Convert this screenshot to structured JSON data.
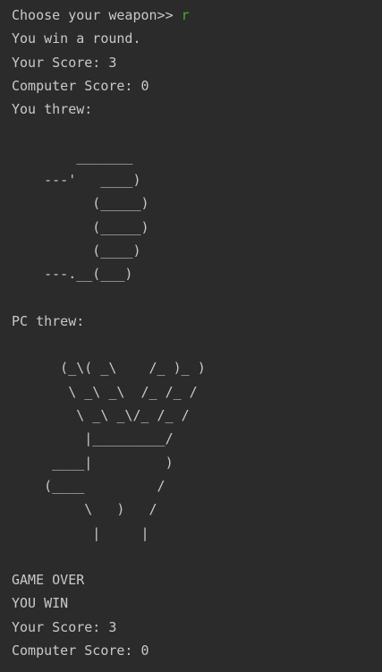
{
  "console": {
    "prompt": "Choose your weapon>> ",
    "user_input": "r",
    "round_result": "You win a round.",
    "score_line_1": "Your Score: 3",
    "computer_score_line_1": "Computer Score: 0",
    "you_threw_label": "You threw:",
    "rock_art": "        _______\n    ---'   ____)\n          (_____)\n          (_____)\n          (____)\n    ---.__(___)",
    "pc_threw_label": "PC threw:",
    "scissors_art": "      (_\\( _\\    /_ )_ )\n       \\ _\\ _\\  /_ /_ /\n        \\ _\\ _\\/_ /_ /\n         |_________/\n     ____|         )\n    (____         /\n         \\   )   /\n          |     |",
    "game_over": "GAME OVER",
    "winner": "YOU WIN",
    "score_line_2": "Your Score: 3",
    "computer_score_line_2": "Computer Score: 0"
  },
  "colors": {
    "background": "#2b2b2b",
    "text": "#c9c9c9",
    "input": "#4fa832"
  }
}
